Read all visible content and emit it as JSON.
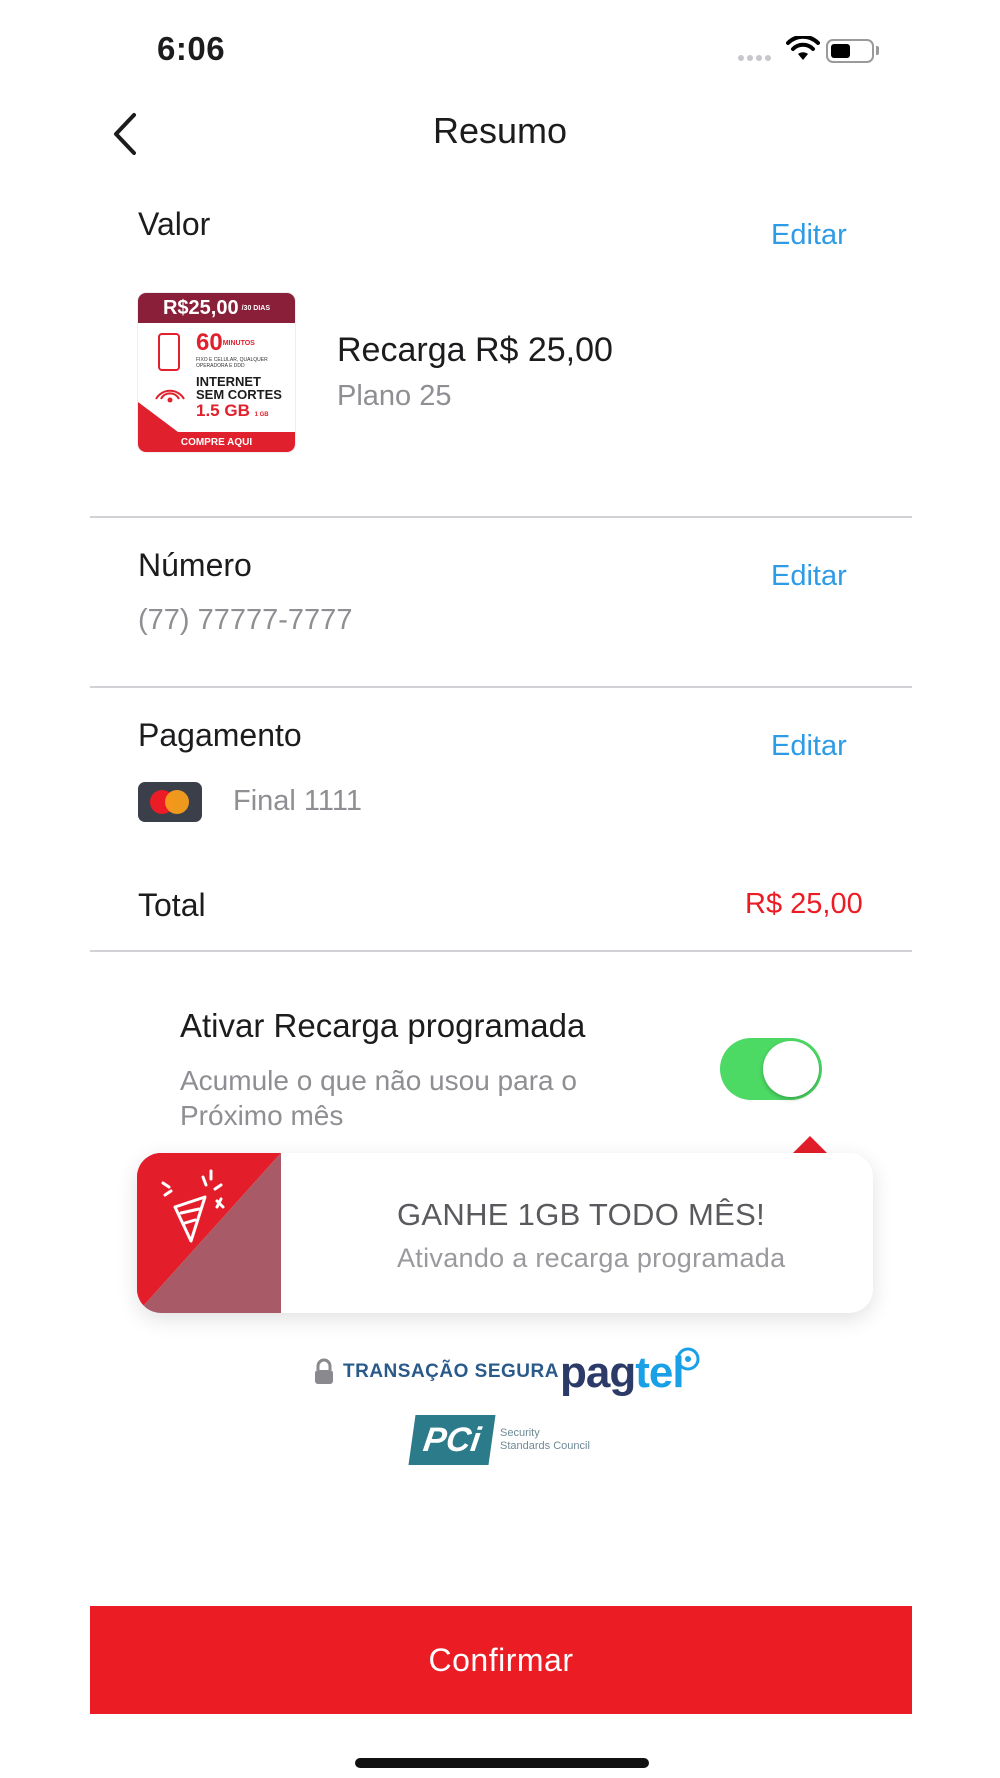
{
  "status_bar": {
    "time": "6:06"
  },
  "header": {
    "title": "Resumo"
  },
  "valor": {
    "label": "Valor",
    "edit": "Editar",
    "product_title": "Recarga R$ 25,00",
    "product_subtitle": "Plano 25",
    "card": {
      "price": "R$25,00",
      "period": "/30 DIAS",
      "minutes": "60",
      "minutes_unit": "MINUTOS",
      "minutes_desc": "FIXO E CELULAR, QUALQUER OPERADORA E DDD",
      "internet_line1": "INTERNET",
      "internet_line2": "SEM CORTES",
      "data": "1.5 GB",
      "data_small": "1 GB",
      "cta": "COMPRE AQUI"
    }
  },
  "numero": {
    "label": "Número",
    "edit": "Editar",
    "value": "(77) 77777-7777"
  },
  "pagamento": {
    "label": "Pagamento",
    "edit": "Editar",
    "card_final": "Final 1111",
    "card_icon": "mastercard-icon"
  },
  "total": {
    "label": "Total",
    "value": "R$ 25,00",
    "color": "#ec1c24"
  },
  "recarga_programada": {
    "title": "Ativar Recarga programada",
    "desc_line1": "Acumule o que não usou para o",
    "desc_line2": "Próximo mês",
    "enabled": true,
    "toggle_color": "#4cd964"
  },
  "promo": {
    "headline": "GANHE 1GB TODO MÊS!",
    "subline": "Ativando a recarga programada",
    "icon": "party-popper-icon"
  },
  "security": {
    "secure_text": "TRANSAÇÃO SEGURA",
    "brand_pag": "pag",
    "brand_tel": "tel",
    "pci_text": "PCi",
    "pci_line1": "Security",
    "pci_line2": "Standards Council"
  },
  "confirm_button": {
    "label": "Confirmar",
    "color": "#ec1c24"
  }
}
